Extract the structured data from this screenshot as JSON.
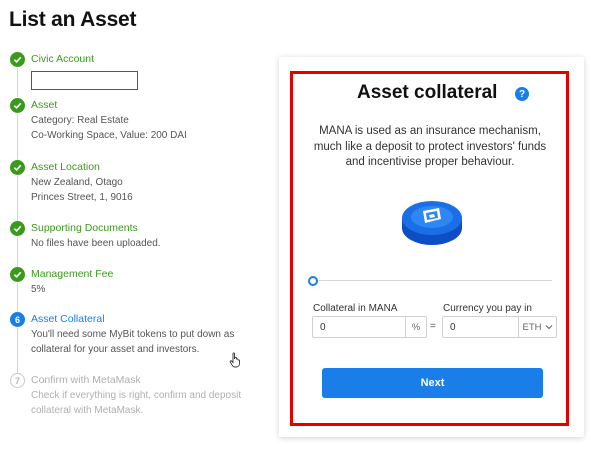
{
  "page": {
    "title": "List an Asset"
  },
  "steps": [
    {
      "number": "1",
      "status": "done",
      "title": "Civic Account",
      "lines": [],
      "input_value": ""
    },
    {
      "number": "2",
      "status": "done",
      "title": "Asset",
      "lines": [
        "Category: Real Estate",
        "Co-Working Space, Value: 200 DAI"
      ]
    },
    {
      "number": "3",
      "status": "done",
      "title": "Asset Location",
      "lines": [
        "New Zealand, Otago",
        "Princes Street, 1, 9016"
      ]
    },
    {
      "number": "4",
      "status": "done",
      "title": "Supporting Documents",
      "lines": [
        "No files have been uploaded."
      ]
    },
    {
      "number": "5",
      "status": "done",
      "title": "Management Fee",
      "lines": [
        "5%"
      ]
    },
    {
      "number": "6",
      "status": "current",
      "title": "Asset Collateral",
      "lines": [
        "You'll need some MyBit tokens to put down as",
        "collateral for your asset and investors."
      ]
    },
    {
      "number": "7",
      "status": "pending",
      "title": "Confirm with MetaMask",
      "lines": [
        "Check if everything is right, confirm and deposit",
        "collateral with MetaMask."
      ]
    }
  ],
  "card": {
    "title": "Asset collateral",
    "help_icon": "?",
    "description": "MANA is used as an insurance mechanism, much like a deposit to protect investors' funds and incentivise proper behaviour.",
    "coin_icon": "mana-coin-icon",
    "slider": {
      "value": 0
    },
    "collateral": {
      "label": "Collateral in MANA",
      "value": "0",
      "unit": "%"
    },
    "equals": "=",
    "currency": {
      "label": "Currency you pay in",
      "value": "0",
      "selected": "ETH"
    },
    "next_label": "Next"
  },
  "colors": {
    "done": "#3a9a1c",
    "accent": "#1a7ee8",
    "highlight": "#e20000"
  }
}
